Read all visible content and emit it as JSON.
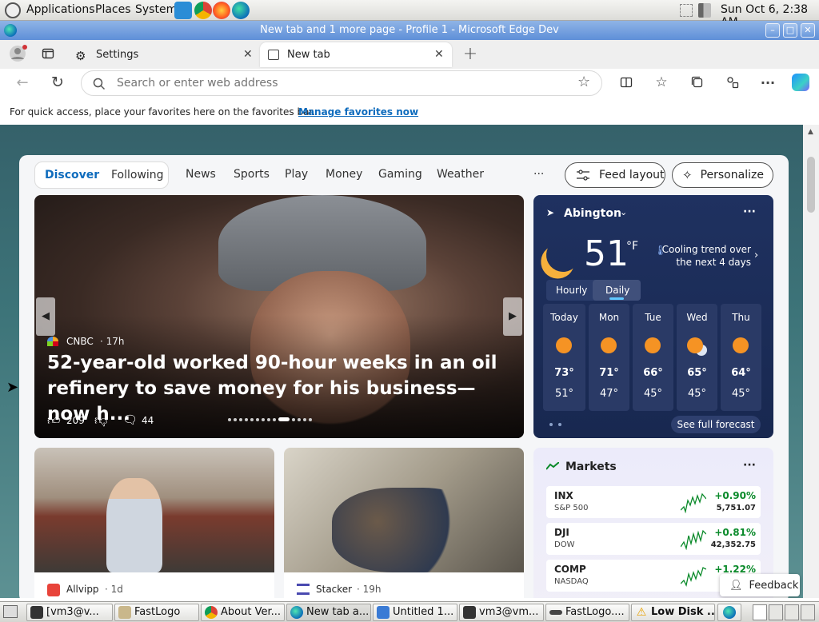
{
  "topbar": {
    "applications": "Applications",
    "places": "Places",
    "system": "System",
    "datetime": "Sun Oct  6,  2:38 AM"
  },
  "window": {
    "title": "New tab and 1 more page - Profile 1 - Microsoft Edge Dev"
  },
  "tabs": [
    {
      "label": "Settings"
    },
    {
      "label": "New tab"
    }
  ],
  "address": {
    "placeholder": "Search or enter web address"
  },
  "favbar": {
    "text": "For quick access, place your favorites here on the favorites bar.",
    "link": "Manage favorites now"
  },
  "feed": {
    "nav": [
      "Discover",
      "Following",
      "News",
      "Sports",
      "Play",
      "Money",
      "Gaming",
      "Weather"
    ],
    "more": "···",
    "feed_layout": "Feed layout",
    "personalize": "Personalize"
  },
  "hero": {
    "source": "CNBC",
    "age": "· 17h",
    "headline": "52-year-old worked 90-hour weeks in an oil refinery to save money for his business—now h...",
    "likes": "209",
    "comments": "44"
  },
  "weather": {
    "location": "Abington",
    "temp": "51",
    "unit": "°F",
    "trend": "Cooling trend over the next 4 days",
    "tab_hourly": "Hourly",
    "tab_daily": "Daily",
    "days": [
      {
        "day": "Today",
        "hi": "73°",
        "lo": "51°"
      },
      {
        "day": "Mon",
        "hi": "71°",
        "lo": "47°"
      },
      {
        "day": "Tue",
        "hi": "66°",
        "lo": "45°"
      },
      {
        "day": "Wed",
        "hi": "65°",
        "lo": "45°"
      },
      {
        "day": "Thu",
        "hi": "64°",
        "lo": "45°"
      }
    ],
    "forecast_link": "See full forecast"
  },
  "markets": {
    "title": "Markets",
    "rows": [
      {
        "symbol": "INX",
        "name": "S&P 500",
        "change": "+0.90%",
        "value": "5,751.07"
      },
      {
        "symbol": "DJI",
        "name": "DOW",
        "change": "+0.81%",
        "value": "42,352.75"
      },
      {
        "symbol": "COMP",
        "name": "NASDAQ",
        "change": "+1.22%",
        "value": ""
      }
    ]
  },
  "cards": [
    {
      "source": "Allvipp",
      "age": "· 1d"
    },
    {
      "source": "Stacker",
      "age": "· 19h"
    }
  ],
  "feedback": "Feedback",
  "taskbar": [
    "[vm3@v...",
    "FastLogo",
    "About Ver...",
    "New tab a...",
    "Untitled 1...",
    "vm3@vm...",
    "FastLogo....",
    "Low Disk ..."
  ],
  "colors": {
    "accent": "#0f6cbd",
    "weather_bg": "#1b2c57",
    "up": "#0a8a2a"
  }
}
